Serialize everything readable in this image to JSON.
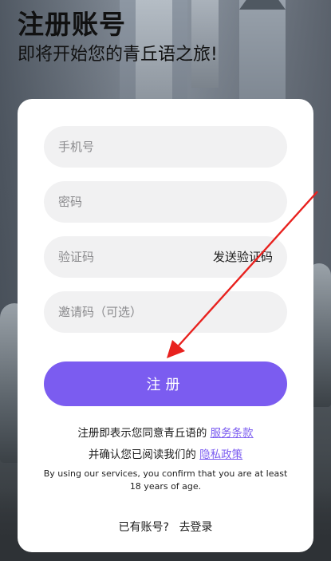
{
  "header": {
    "title": "注册账号",
    "subtitle": "即将开始您的青丘语之旅!"
  },
  "form": {
    "phone_placeholder": "手机号",
    "password_placeholder": "密码",
    "code_placeholder": "验证码",
    "send_code_label": "发送验证码",
    "invite_placeholder": "邀请码（可选）",
    "submit_label": "注册"
  },
  "terms": {
    "line1_text": "注册即表示您同意青丘语的",
    "service_link": "服务条款",
    "line2_text": "并确认您已阅读我们的",
    "privacy_link": "隐私政策",
    "english_note": "By using our services, you confirm that you are at least 18 years of age."
  },
  "footer": {
    "have_account": "已有账号?",
    "login_link": "去登录"
  },
  "colors": {
    "accent": "#7b5cf0",
    "annotation_arrow": "#e8211e"
  }
}
